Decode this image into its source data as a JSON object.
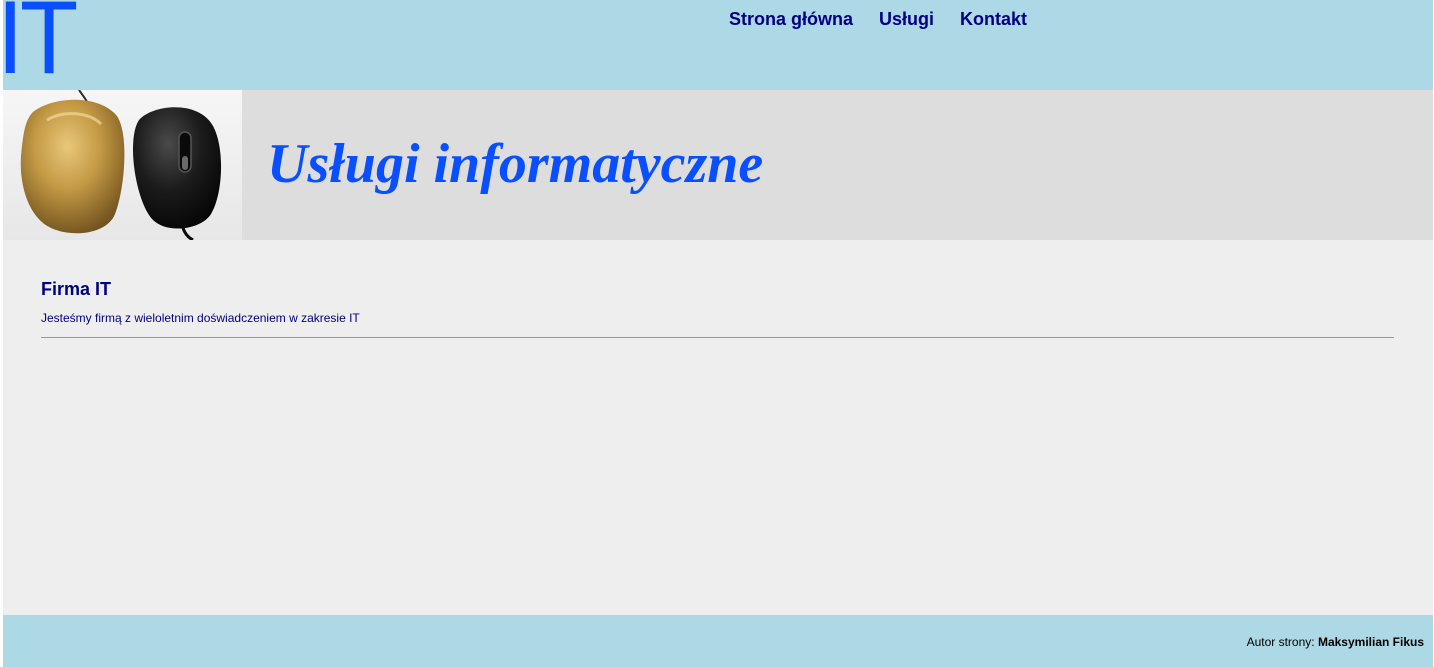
{
  "header": {
    "logo_text": "IT",
    "nav": [
      "Strona główna",
      "Usługi",
      "Kontakt"
    ]
  },
  "banner": {
    "image_alt": "mouse-photo",
    "title": "Usługi informatyczne"
  },
  "main": {
    "heading": "Firma IT",
    "description": "Jesteśmy firmą z wieloletnim doświadczeniem w zakresie IT"
  },
  "footer": {
    "label": "Autor strony: ",
    "author": "Maksymilian Fikus"
  },
  "colors": {
    "header_bg": "#add8e6",
    "banner_bg": "#dddddd",
    "page_bg": "#eeeeee",
    "accent_blue": "#0a4fff",
    "nav_text": "#000080"
  }
}
